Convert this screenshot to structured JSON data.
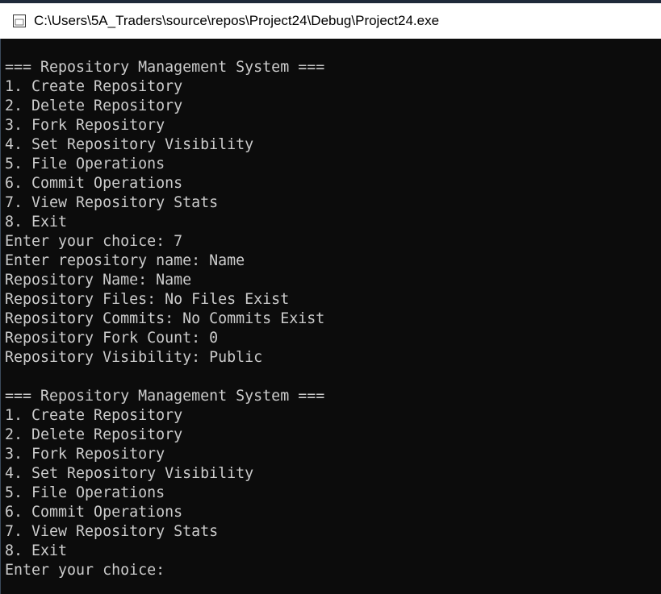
{
  "window": {
    "title": "C:\\Users\\5A_Traders\\source\\repos\\Project24\\Debug\\Project24.exe",
    "icon": "console-app-icon"
  },
  "console": {
    "lines": [
      "=== Repository Management System ===",
      "1. Create Repository",
      "2. Delete Repository",
      "3. Fork Repository",
      "4. Set Repository Visibility",
      "5. File Operations",
      "6. Commit Operations",
      "7. View Repository Stats",
      "8. Exit",
      "Enter your choice: 7",
      "Enter repository name: Name",
      "Repository Name: Name",
      "Repository Files: No Files Exist",
      "Repository Commits: No Commits Exist",
      "Repository Fork Count: 0",
      "Repository Visibility: Public",
      "",
      "=== Repository Management System ===",
      "1. Create Repository",
      "2. Delete Repository",
      "3. Fork Repository",
      "4. Set Repository Visibility",
      "5. File Operations",
      "6. Commit Operations",
      "7. View Repository Stats",
      "8. Exit",
      "Enter your choice: "
    ]
  },
  "colors": {
    "console_bg": "#0c0c0c",
    "console_text": "#cccccc",
    "titlebar_bg": "#ffffff"
  }
}
